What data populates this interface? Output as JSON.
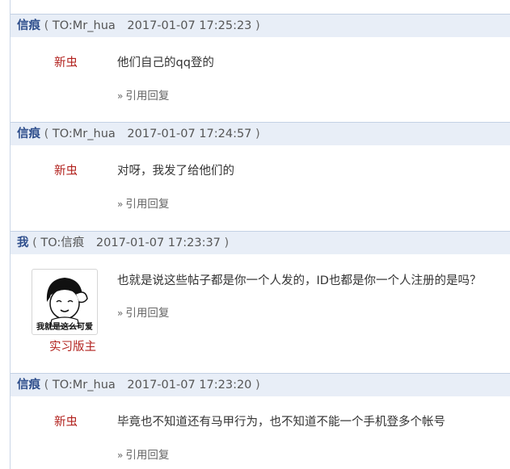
{
  "posts": [
    {
      "author": "信痕",
      "to_prefix": "TO:",
      "to": "Mr_hua",
      "timestamp": "2017-01-07 17:25:23",
      "sender": "新虫",
      "message": "他们自己的qq登的",
      "reply_label": "引用回复"
    },
    {
      "author": "信痕",
      "to_prefix": "TO:",
      "to": "Mr_hua",
      "timestamp": "2017-01-07 17:24:57",
      "sender": "新虫",
      "message": "对呀，我发了给他们的",
      "reply_label": "引用回复"
    },
    {
      "author": "我",
      "to_prefix": "TO:",
      "to": "信痕",
      "timestamp": "2017-01-07 17:23:37",
      "avatar_caption": "我就是这么可爱",
      "sender_title": "实习版主",
      "message": "也就是说这些帖子都是你一个人发的，ID也都是你一个人注册的是吗？",
      "reply_label": "引用回复"
    },
    {
      "author": "信痕",
      "to_prefix": "TO:",
      "to": "Mr_hua",
      "timestamp": "2017-01-07 17:23:20",
      "sender": "新虫",
      "message": "毕竟也不知道还有马甲行为，也不知道不能一个手机登多个帐号",
      "reply_label": "引用回复"
    }
  ],
  "symbols": {
    "open_paren": "(",
    "close_paren": ")",
    "raquo": "»"
  },
  "colors": {
    "author": "#2e4e8c",
    "sender": "#b2221e",
    "header_bg": "#e8eef7"
  },
  "icons": {
    "avatar": "meme-face-avatar-icon"
  }
}
